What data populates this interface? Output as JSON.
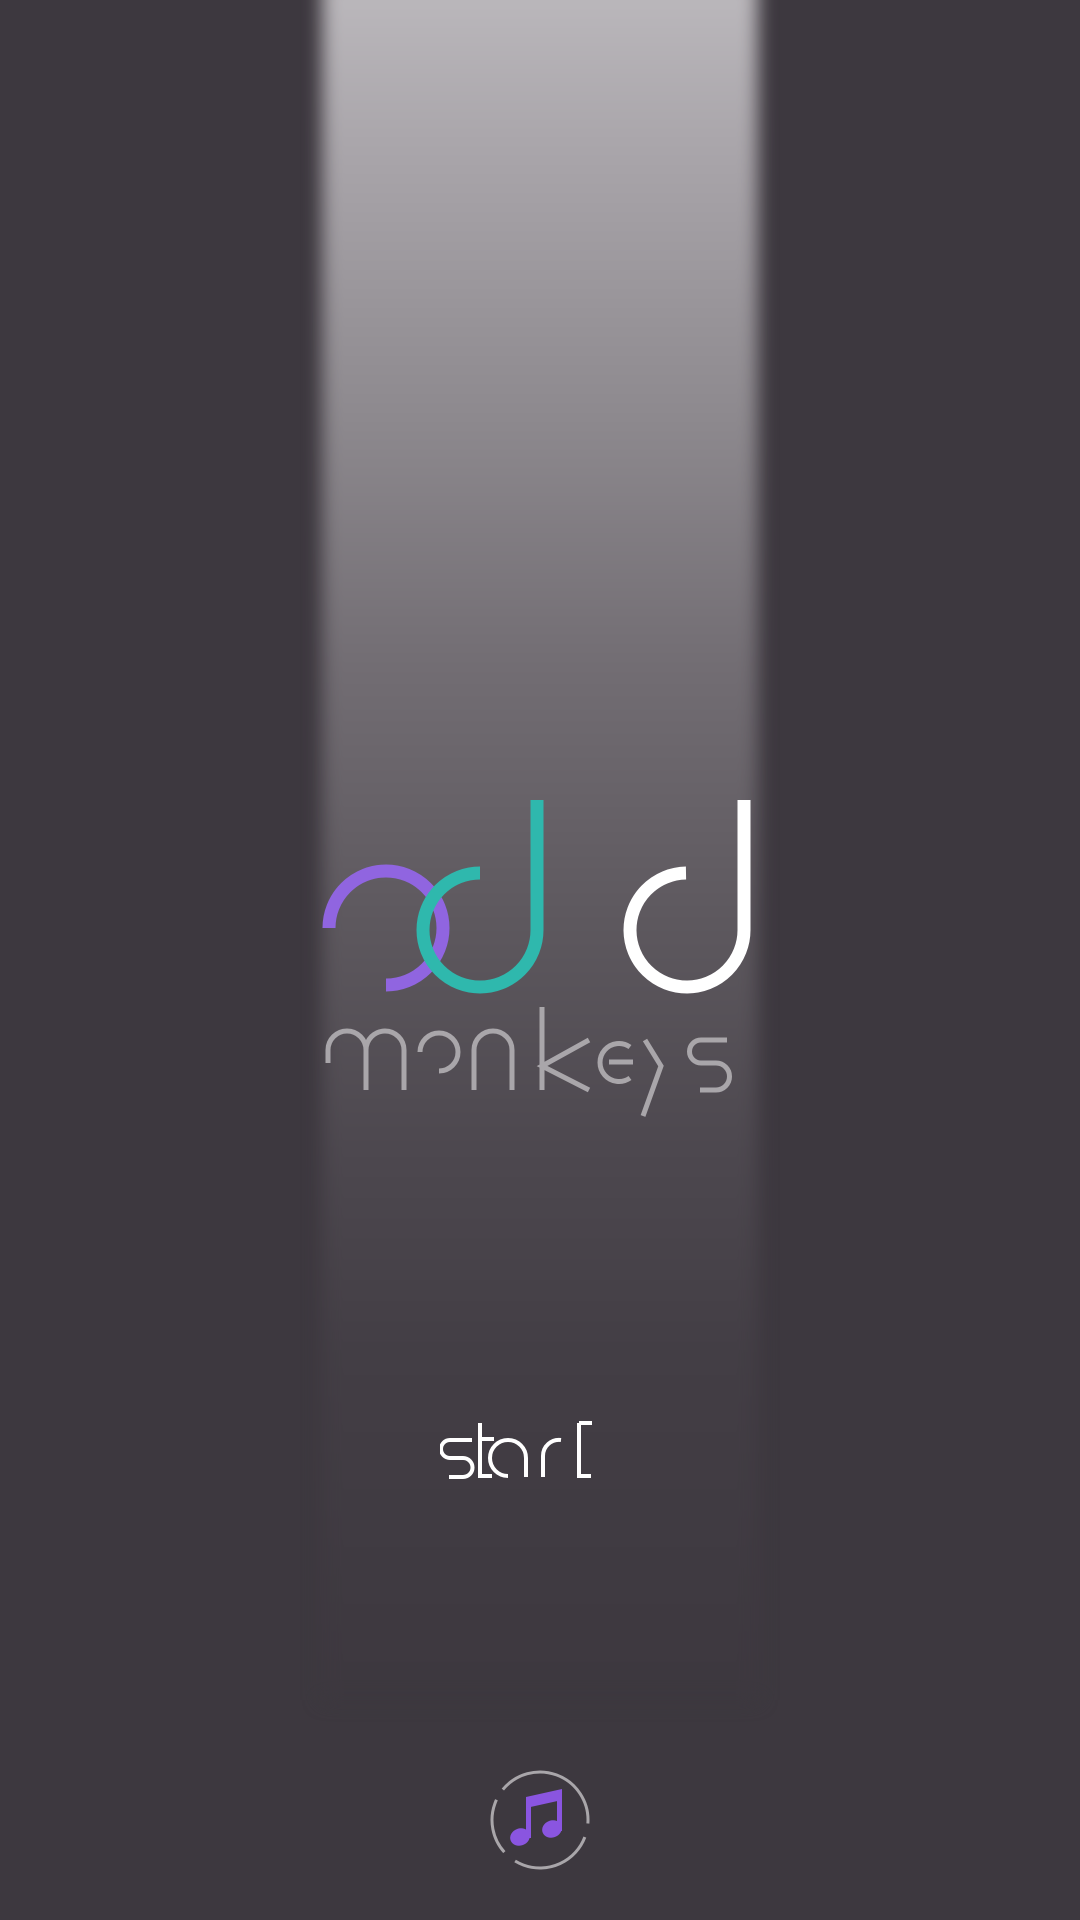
{
  "logo": {
    "line1": "odd",
    "line2": "monkeys",
    "colors": {
      "o": "#9065e0",
      "d1": "#2fb8ad",
      "d2": "#ffffff",
      "subtitle": "#a9a6aa"
    }
  },
  "start_button": {
    "label": "start",
    "color": "#ffffff"
  },
  "music_toggle": {
    "icon": "music-note-icon",
    "icon_color": "#8a55e0",
    "ring_color": "#a9a6aa"
  },
  "theme": {
    "background": "#3d383f",
    "beam_top": "#bcb9bd"
  }
}
